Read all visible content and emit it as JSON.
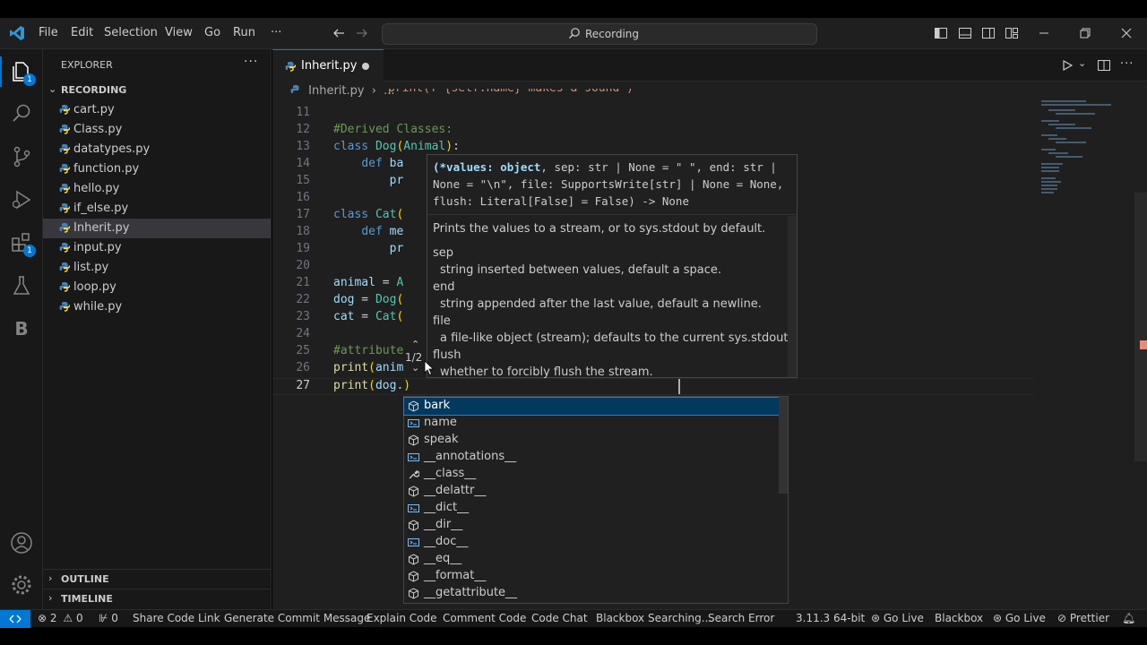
{
  "titlebar": {
    "menu": [
      "File",
      "Edit",
      "Selection",
      "View",
      "Go",
      "Run",
      "···"
    ],
    "search": "Recording"
  },
  "activity": {
    "explorer_badge": "1",
    "extensions_badge": "1",
    "b_label": "B"
  },
  "sidebar": {
    "title": "EXPLORER",
    "more": "···",
    "folder": "RECORDING",
    "files": [
      "cart.py",
      "Class.py",
      "datatypes.py",
      "function.py",
      "hello.py",
      "if_else.py",
      "Inherit.py",
      "input.py",
      "list.py",
      "loop.py",
      "while.py"
    ],
    "selected": "Inherit.py",
    "outline": "OUTLINE",
    "timeline": "TIMELINE"
  },
  "editor": {
    "tab": "Inherit.py",
    "breadcrumb": {
      "file": "Inherit.py",
      "rest": "..."
    },
    "partial_top": "print(f\"{self.name} makes a sound\")",
    "lines": [
      {
        "n": "11",
        "t": ""
      },
      {
        "n": "12",
        "t": "#Derived Classes:"
      },
      {
        "n": "13",
        "t": "class Dog(Animal):"
      },
      {
        "n": "14",
        "t": "    def ba"
      },
      {
        "n": "15",
        "t": "        pr"
      },
      {
        "n": "16",
        "t": ""
      },
      {
        "n": "17",
        "t": "class Cat("
      },
      {
        "n": "18",
        "t": "    def me"
      },
      {
        "n": "19",
        "t": "        pr"
      },
      {
        "n": "20",
        "t": ""
      },
      {
        "n": "21",
        "t": "animal = A"
      },
      {
        "n": "22",
        "t": "dog = Dog("
      },
      {
        "n": "23",
        "t": "cat = Cat("
      },
      {
        "n": "24",
        "t": ""
      },
      {
        "n": "25",
        "t": "#attribute"
      },
      {
        "n": "26",
        "t": "print(anim"
      },
      {
        "n": "27",
        "t": "print(dog.)"
      }
    ]
  },
  "hover": {
    "sig1": "(*values: object, sep: str | None = \" \", end: str |",
    "sig2": "None = \"\\n\", file: SupportsWrite[str] | None = None,",
    "sig3": "flush: Literal[False] = False) -> None",
    "desc": "Prints the values to a stream, or to sys.stdout by default.",
    "p1": "sep",
    "d1": "string inserted between values, default a space.",
    "p2": "end",
    "d2": "string appended after the last value, default a newline.",
    "p3": "file",
    "d3": "a file-like object (stream); defaults to the current sys.stdout.",
    "p4": "flush",
    "d4": "whether to forcibly flush the stream.",
    "paging": "1/2"
  },
  "suggest": {
    "items": [
      {
        "label": "bark",
        "kind": "method"
      },
      {
        "label": "name",
        "kind": "field"
      },
      {
        "label": "speak",
        "kind": "method"
      },
      {
        "label": "__annotations__",
        "kind": "field"
      },
      {
        "label": "__class__",
        "kind": "wrench"
      },
      {
        "label": "__delattr__",
        "kind": "method"
      },
      {
        "label": "__dict__",
        "kind": "field"
      },
      {
        "label": "__dir__",
        "kind": "method"
      },
      {
        "label": "__doc__",
        "kind": "field"
      },
      {
        "label": "__eq__",
        "kind": "method"
      },
      {
        "label": "__format__",
        "kind": "method"
      },
      {
        "label": "__getattribute__",
        "kind": "method"
      }
    ]
  },
  "status": {
    "problems_errors": "2",
    "problems_warnings": "0",
    "ports": "0",
    "items": [
      "Share Code Link",
      "Generate Commit Message",
      "Explain Code",
      "Comment Code",
      "Code Chat",
      "Blackbox Searching...",
      "Search Error"
    ],
    "python": "3.11.3 64-bit",
    "golive1": "Go Live",
    "blackbox": "Blackbox",
    "golive2": "Go Live",
    "prettier": "Prettier"
  },
  "colors": {
    "accent": "#0078d4",
    "background": "#1f1f1f",
    "sidebar": "#181818",
    "keyword": "#569cd6",
    "class": "#4ec9b0",
    "comment": "#6a9955"
  }
}
